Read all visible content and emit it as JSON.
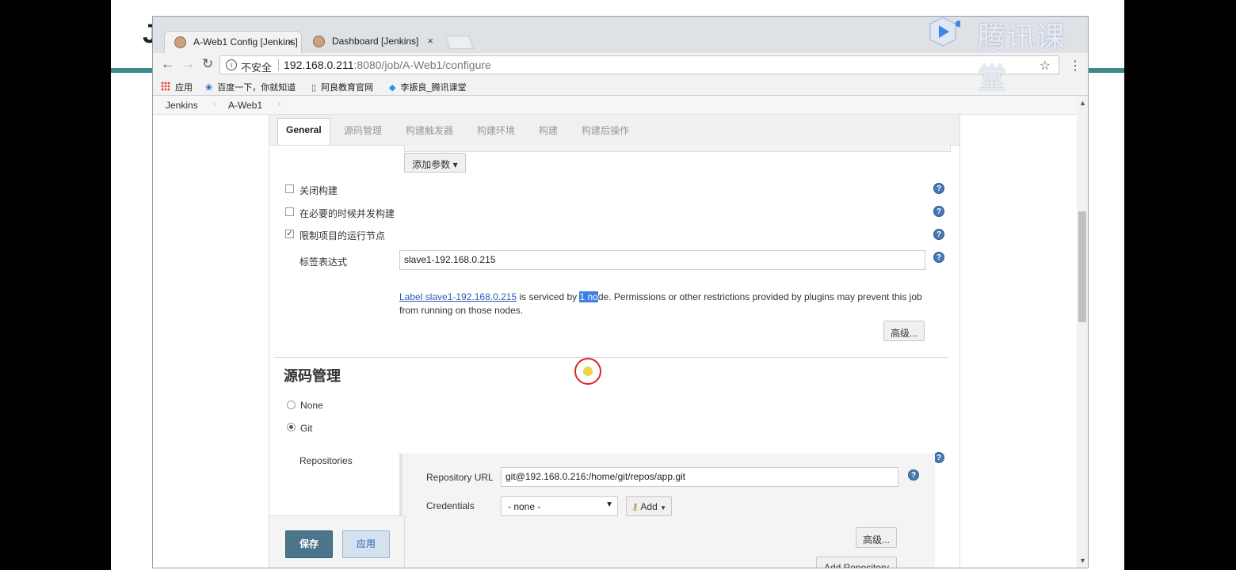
{
  "browser": {
    "tabs": [
      {
        "title": "A-Web1 Config [Jenkins]"
      },
      {
        "title": "Dashboard [Jenkins]"
      }
    ],
    "tab_close_glyph": "×",
    "security_label": "不安全",
    "url_host": "192.168.0.211",
    "url_rest": ":8080/job/A-Web1/configure",
    "bookmarks": [
      "应用",
      "百度一下，你就知道",
      "阿良教育官网",
      "李振良_腾讯课堂"
    ]
  },
  "breadcrumb": [
    "Jenkins",
    "A-Web1"
  ],
  "section_tabs": [
    "General",
    "源码管理",
    "构建触发器",
    "构建环境",
    "构建",
    "构建后操作"
  ],
  "general": {
    "add_param_label": "添加参数",
    "options": [
      {
        "label": "关闭构建",
        "checked": false
      },
      {
        "label": "在必要的时候并发构建",
        "checked": false
      },
      {
        "label": "限制项目的运行节点",
        "checked": true
      }
    ],
    "label_expr_label": "标签表达式",
    "label_expr_value": "slave1-192.168.0.215",
    "notice_link": "Label slave1-192.168.0.215",
    "notice_mid": " is serviced by ",
    "notice_highlight": "1 no",
    "notice_tail": "de. Permissions or other restrictions provided by plugins may prevent this job from running on those nodes.",
    "advanced_label": "高级..."
  },
  "scm": {
    "title": "源码管理",
    "options": [
      {
        "label": "None",
        "selected": false
      },
      {
        "label": "Git",
        "selected": true
      }
    ],
    "repositories_label": "Repositories",
    "repo_url_label": "Repository URL",
    "repo_url_value": "git@192.168.0.216:/home/git/repos/app.git",
    "credentials_label": "Credentials",
    "credentials_value": "- none -",
    "add_label": "Add",
    "advanced_label": "高级...",
    "add_repo_label": "Add Repository"
  },
  "footer": {
    "save_label": "保存",
    "apply_label": "应用"
  },
  "watermark": {
    "text": "腾讯课堂"
  },
  "colors": {
    "slide_accent": "#3e8a8a",
    "save_button": "#4b758b",
    "help_icon": "#4a78b0",
    "link": "#2a5db0"
  }
}
